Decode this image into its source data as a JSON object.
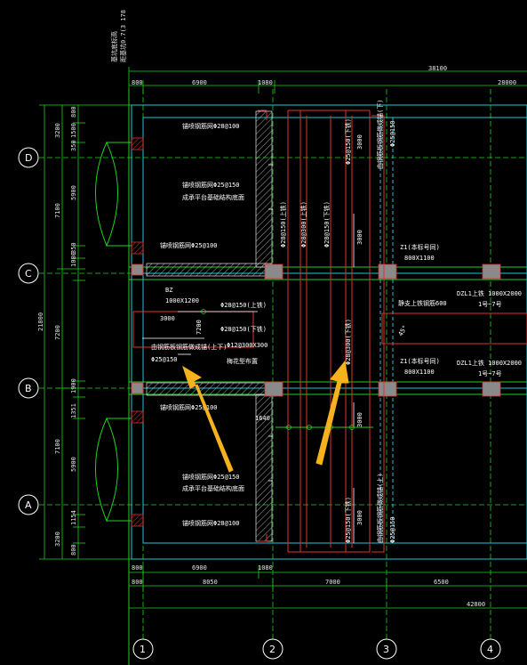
{
  "top_note": {
    "line1": "基坑底标高",
    "line2": "距基坑0.7(3 178"
  },
  "grid_axes": {
    "columns": [
      "1",
      "2",
      "3",
      "4"
    ],
    "rows": [
      "D",
      "C",
      "B",
      "A"
    ]
  },
  "dims_top": {
    "total": "38100",
    "d1": "800",
    "d2": "6900",
    "d3": "1080",
    "d4": "28000"
  },
  "dims_bottom": {
    "row1": {
      "d1": "800",
      "d2": "6900",
      "d3": "1080"
    },
    "row2": {
      "d1": "800",
      "d2": "8050",
      "d3": "7000",
      "d4": "6500"
    },
    "total": "42800"
  },
  "dims_left": {
    "outer": {
      "d1": "7100",
      "d2": "7200",
      "d3": "7100",
      "total": "21800"
    },
    "mid": {
      "d1": "3200",
      "d2": "1000",
      "d3": "3200"
    },
    "inner": [
      "800",
      "1500",
      "350",
      "5900",
      "350",
      "1080",
      "1080",
      "1900",
      "350",
      "1351",
      "5900",
      "1154",
      "350",
      "800"
    ]
  },
  "labels": {
    "l1": "锚喷钢筋网Φ28@100",
    "l2": "锚喷钢筋网Φ25@150",
    "l3": "成承平台基础结构底面",
    "l4": "锚喷钢筋网Φ25@100",
    "bz": "BZ",
    "bz_size": "1000X1200",
    "l5": "Φ28@150(上铁)",
    "l6": "Φ28@150(下铁)",
    "l7": "Φ12@300X300",
    "l8": "梅花型布置",
    "l9": "Φ25@150",
    "l10": "锚喷钢筋网Φ25@100",
    "l11": "锚喷钢筋网Φ25@150",
    "l12": "成承平台基础结构底面",
    "l13": "锚喷钢筋网Φ28@100",
    "d_3000a": "3000",
    "d_7200": "7200",
    "d_1640": "1640",
    "lb_side": "由钢筋板钢筋做成锚(上下)",
    "v1": "Φ28@150(上铁)",
    "v2": "Φ28@300(上铁)",
    "v3": "Φ28@150(下铁)",
    "v4": "Φ25@150(下铁)",
    "v5": "Φ28@300(下铁)",
    "v6": "Φ25@150(下铁)",
    "v7": "3000",
    "v8": "3000",
    "v9": "3000",
    "v10": "3000",
    "rv1": "由钢筋板钢筋做成锚(下)",
    "rv2": "由钢筋板钢筋做成锚(上)",
    "rv3": "Φ25@150",
    "rv4": "Φ25@150",
    "z1a": "Z1(本标号同)",
    "z1a_size": "800X1100",
    "z1b": "Z1(本标号同)",
    "z1b_size": "800X1100",
    "dzl1a": "DZL1上铁 1000X2000",
    "dzl1a_b": "1号~7号",
    "dzl1b": "DZL1上铁 1000X2000",
    "dzl1b_b": "1号~7号",
    "jw": "静支上铁钢筋600",
    "d45": "45°"
  },
  "colors": {
    "grid": "#1fd11f",
    "cyan": "#1ec8d8",
    "red": "#e23030",
    "arrow": "#f5b21c",
    "background": "#000000"
  }
}
